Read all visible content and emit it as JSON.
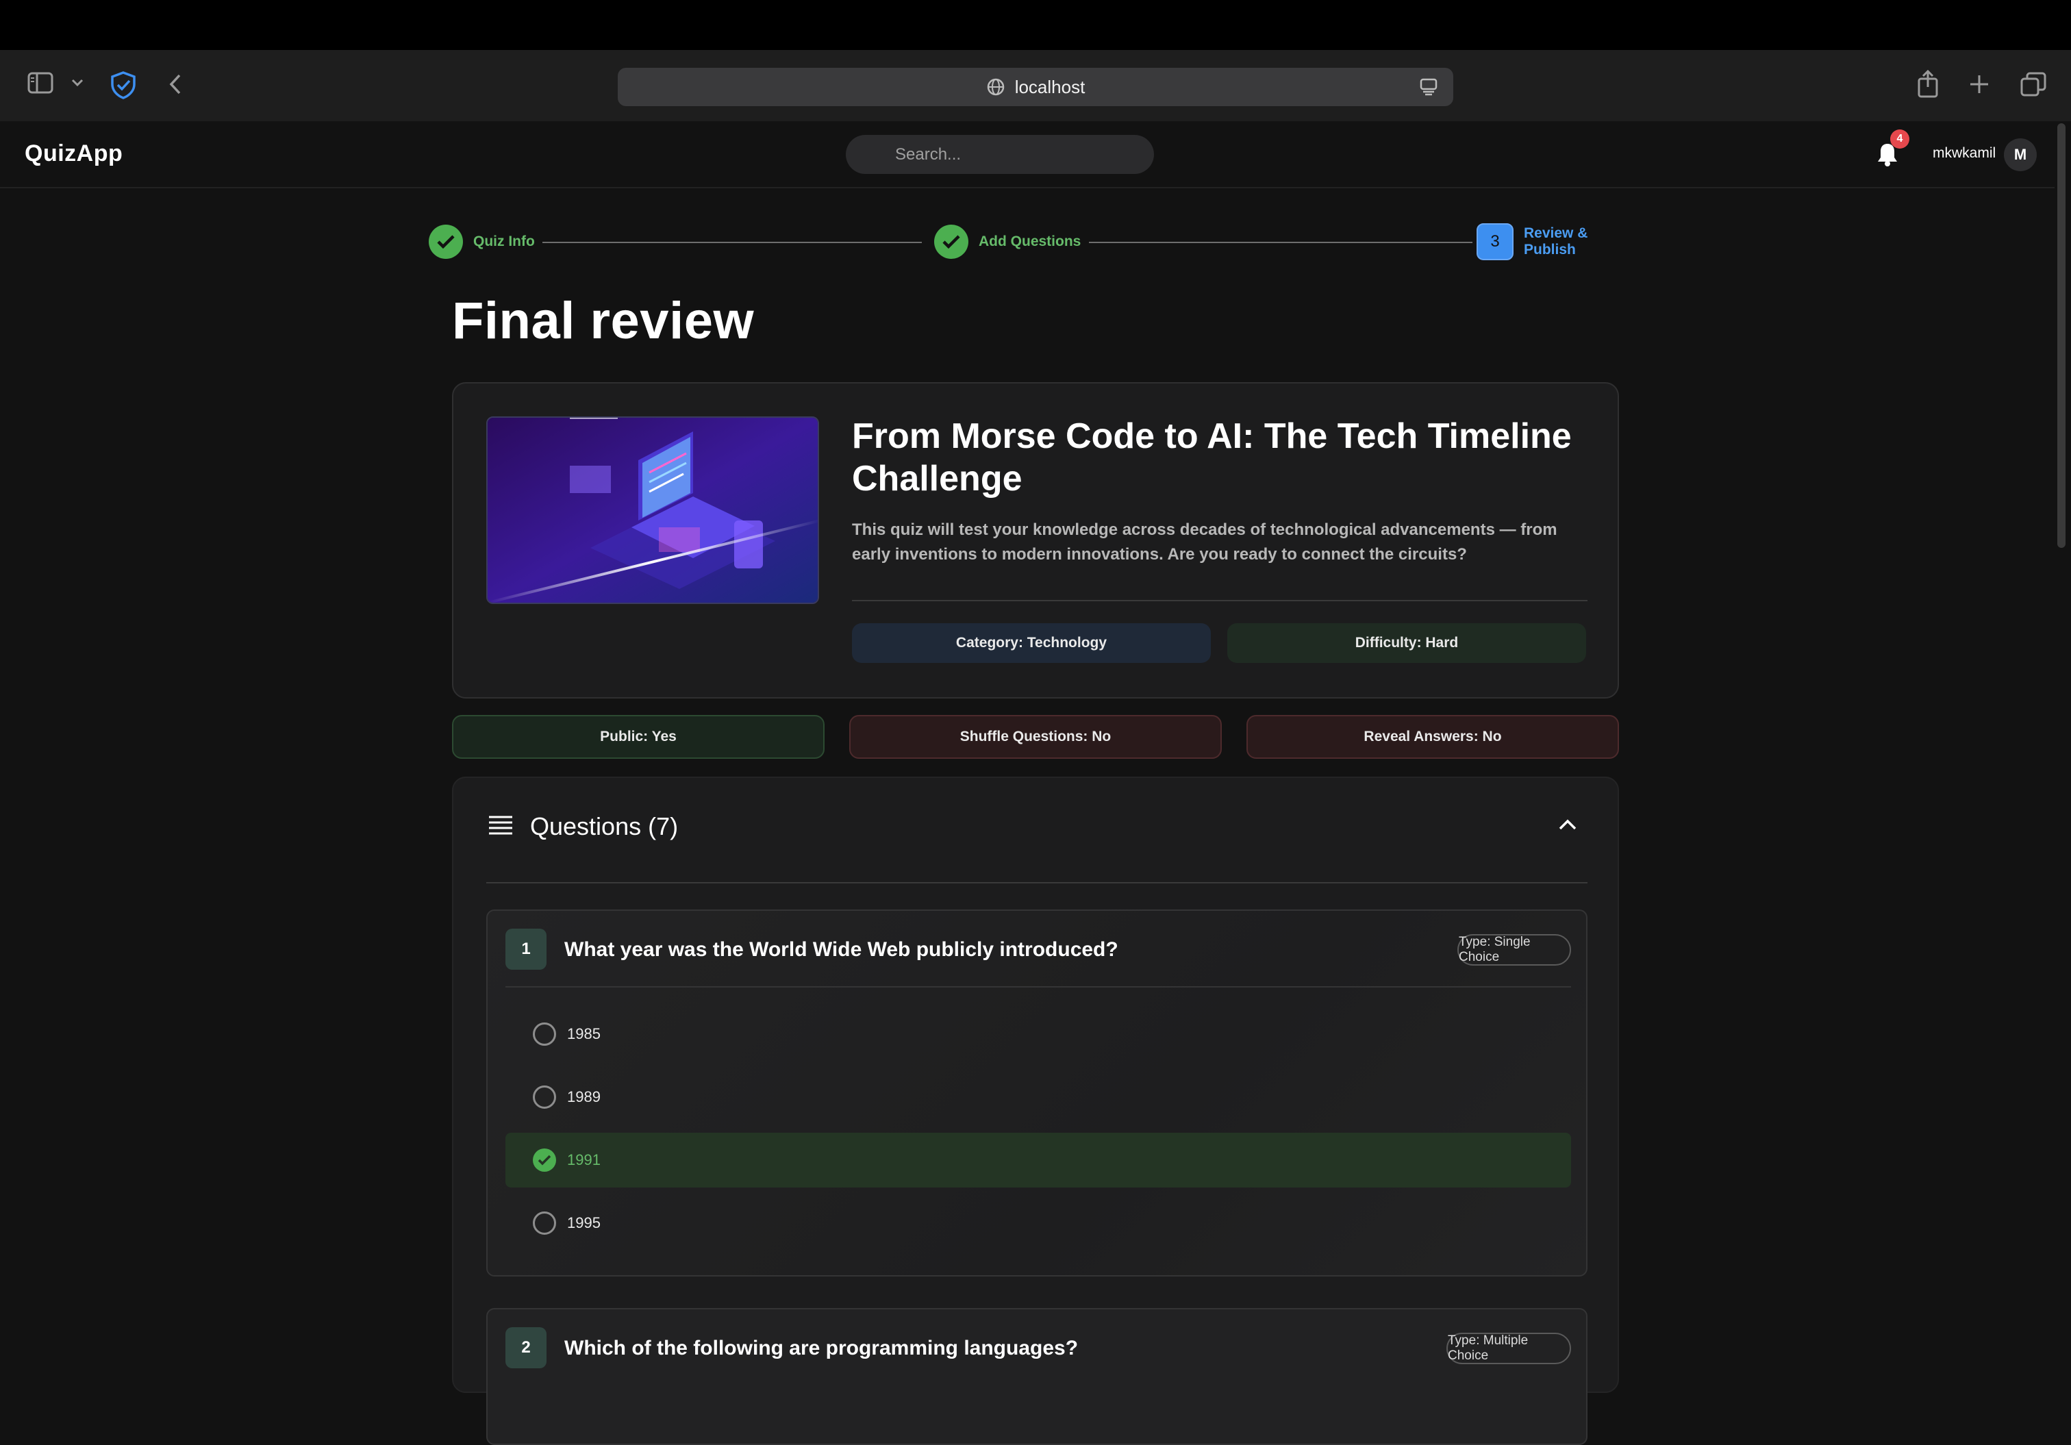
{
  "browser": {
    "url": "localhost",
    "icons": [
      "sidebar-icon",
      "chevron-down-icon",
      "shield-icon",
      "back-icon",
      "globe-icon",
      "reader-icon",
      "share-icon",
      "plus-icon",
      "tabs-icon"
    ]
  },
  "header": {
    "logo": "QuizApp",
    "search_placeholder": "Search...",
    "notification_count": "4",
    "username": "mkwkamil",
    "avatar_initial": "M"
  },
  "stepper": {
    "steps": [
      {
        "label": "Quiz Info",
        "state": "done"
      },
      {
        "label": "Add Questions",
        "state": "done"
      },
      {
        "number": "3",
        "label": "Review & Publish",
        "state": "active"
      }
    ]
  },
  "page": {
    "title": "Final review"
  },
  "quiz": {
    "title": "From Morse Code to AI: The Tech Timeline Challenge",
    "description": "This quiz will test your knowledge across decades of technological advancements — from early inventions to modern innovations. Are you ready to connect the circuits?",
    "category": "Category: Technology",
    "difficulty": "Difficulty: Hard"
  },
  "settings": {
    "public": "Public: Yes",
    "shuffle": "Shuffle Questions: No",
    "reveal": "Reveal Answers: No"
  },
  "questions": {
    "header": "Questions (7)",
    "items": [
      {
        "number": "1",
        "text": "What year was the World Wide Web publicly introduced?",
        "type": "Type: Single Choice",
        "options": [
          {
            "label": "1985",
            "correct": false
          },
          {
            "label": "1989",
            "correct": false
          },
          {
            "label": "1991",
            "correct": true
          },
          {
            "label": "1995",
            "correct": false
          }
        ]
      },
      {
        "number": "2",
        "text": "Which of the following are programming languages?",
        "type": "Type: Multiple Choice"
      }
    ]
  },
  "colors": {
    "accent_green": "#4caf50",
    "accent_blue": "#3d8ff0",
    "badge_red": "#e5484d",
    "background": "#121212"
  }
}
